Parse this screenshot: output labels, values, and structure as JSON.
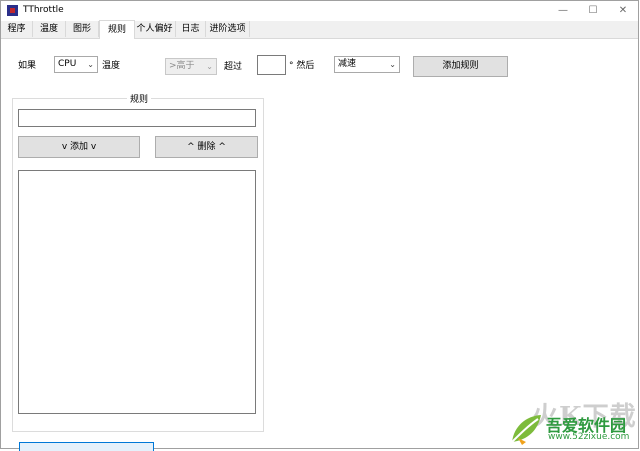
{
  "window": {
    "title": "TThrottle",
    "minimize": "—",
    "maximize": "☐",
    "close": "✕"
  },
  "tabs": [
    {
      "label": "程序"
    },
    {
      "label": "温度"
    },
    {
      "label": "图形"
    },
    {
      "label": "规则",
      "active": true
    },
    {
      "label": "个人偏好"
    },
    {
      "label": "日志"
    },
    {
      "label": "进阶选项"
    }
  ],
  "rule_builder": {
    "if_label": "如果",
    "source_value": "CPU",
    "temperature_label": "温度",
    "comparison_value": ">高于",
    "exceed_label": "超过",
    "threshold_value": "",
    "unit_then_label": "° 然后",
    "action_value": "减速",
    "add_rule_button": "添加规则"
  },
  "rules_group": {
    "title": "规则",
    "rule_text": "",
    "add_button": "v 添加 v",
    "delete_button": "^ 删除 ^",
    "items": []
  },
  "watermark": {
    "big": "火K下载",
    "name": "吾爱软件园",
    "url": "www.52zixue.com"
  }
}
